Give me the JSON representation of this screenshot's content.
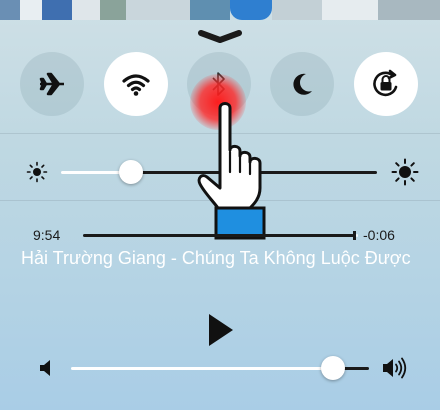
{
  "toggles": {
    "airplane": {
      "icon": "airplane-icon",
      "state": "off"
    },
    "wifi": {
      "icon": "wifi-icon",
      "state": "on"
    },
    "bluetooth": {
      "icon": "bluetooth-icon",
      "state": "off"
    },
    "do_not_disturb": {
      "icon": "moon-icon",
      "state": "off"
    },
    "rotation_lock": {
      "icon": "rotation-lock-icon",
      "state": "on"
    }
  },
  "brightness": {
    "level": 0.22,
    "min_icon": "sun-small-icon",
    "max_icon": "sun-large-icon"
  },
  "now_playing": {
    "elapsed": "9:54",
    "remaining": "-0:06",
    "progress": 0.99,
    "title": "Hải Trường Giang - Chúng Ta Không Luộc Được"
  },
  "controls": {
    "play_icon": "play-icon"
  },
  "volume": {
    "level": 0.88,
    "min_icon": "speaker-low-icon",
    "max_icon": "speaker-high-icon"
  },
  "colors": {
    "accent_tap": "#ff2020",
    "pointer_cuff": "#1f8fe0"
  }
}
